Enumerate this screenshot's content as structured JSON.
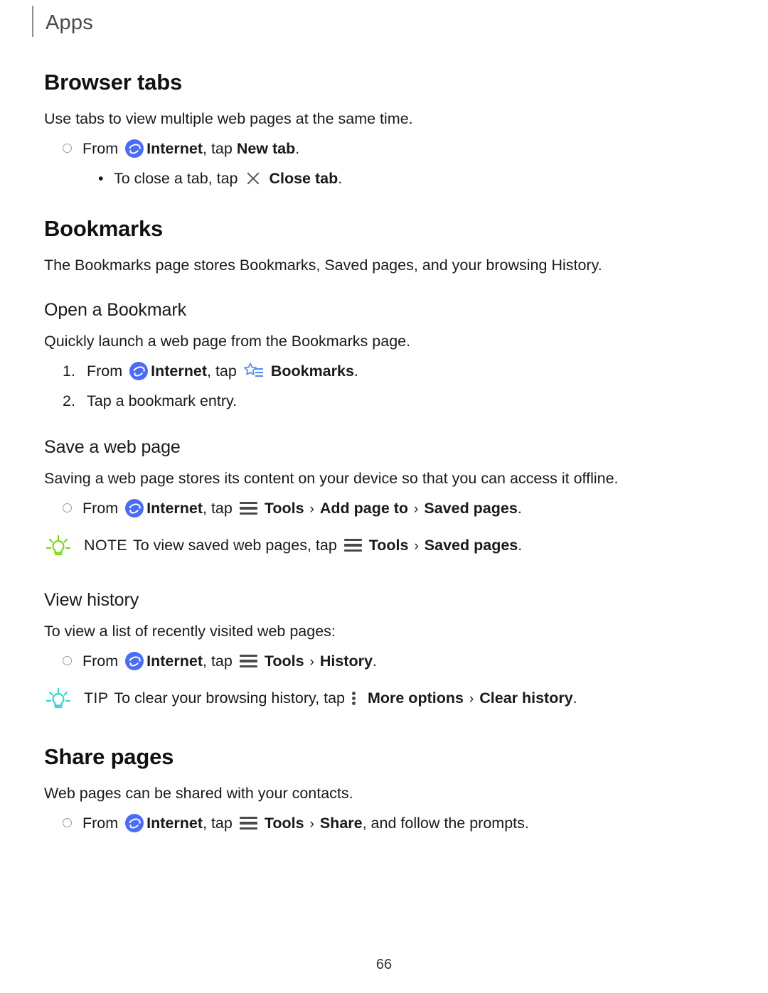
{
  "header": {
    "title": "Apps"
  },
  "sections": {
    "browser_tabs": {
      "heading": "Browser tabs",
      "intro": "Use tabs to view multiple web pages at the same time.",
      "step1_pre": "From",
      "step1_app": "Internet",
      "step1_mid": ", tap ",
      "step1_bold": "New tab",
      "step1_end": ".",
      "sub_bullet_marker": "•",
      "sub_pre": "To close a tab, tap",
      "sub_bold": "Close tab",
      "sub_end": "."
    },
    "bookmarks": {
      "heading": "Bookmarks",
      "intro": "The Bookmarks page stores Bookmarks, Saved pages, and your browsing History.",
      "open_bookmark": {
        "heading": "Open a Bookmark",
        "intro": "Quickly launch a web page from the Bookmarks page.",
        "step1_num": "1.",
        "step1_pre": "From",
        "step1_app": "Internet",
        "step1_mid": ", tap",
        "step1_bold": "Bookmarks",
        "step1_end": ".",
        "step2_num": "2.",
        "step2_text": "Tap a bookmark entry."
      },
      "save_web_page": {
        "heading": "Save a web page",
        "intro": "Saving a web page stores its content on your device so that you can access it offline.",
        "step1_pre": "From",
        "step1_app": "Internet",
        "step1_mid": ", tap",
        "step1_tools": "Tools",
        "step1_chev1": "›",
        "step1_add": "Add page to",
        "step1_chev2": "›",
        "step1_saved": "Saved pages",
        "step1_end": ".",
        "note_label": "NOTE",
        "note_pre": "To view saved web pages, tap",
        "note_tools": "Tools",
        "note_chev": "›",
        "note_saved": "Saved pages",
        "note_end": "."
      },
      "view_history": {
        "heading": "View history",
        "intro": "To view a list of recently visited web pages:",
        "step1_pre": "From",
        "step1_app": "Internet",
        "step1_mid": ", tap",
        "step1_tools": "Tools",
        "step1_chev": "›",
        "step1_history": "History",
        "step1_end": ".",
        "tip_label": "TIP",
        "tip_pre": "To clear your browsing history, tap",
        "tip_more": "More options",
        "tip_chev": "›",
        "tip_clear": "Clear history",
        "tip_end": "."
      }
    },
    "share_pages": {
      "heading": "Share pages",
      "intro": "Web pages can be shared with your contacts.",
      "step1_pre": "From",
      "step1_app": "Internet",
      "step1_mid": ", tap",
      "step1_tools": "Tools",
      "step1_chev": "›",
      "step1_share": "Share",
      "step1_end": ", and follow the prompts."
    }
  },
  "footer": {
    "page_number": "66"
  },
  "colors": {
    "internet_blue": "#4a6cf7",
    "bookmark_star": "#5b8def",
    "note_bulb": "#7ed321",
    "tip_bulb": "#35d2d2",
    "header_gray": "#4a4a4a"
  }
}
